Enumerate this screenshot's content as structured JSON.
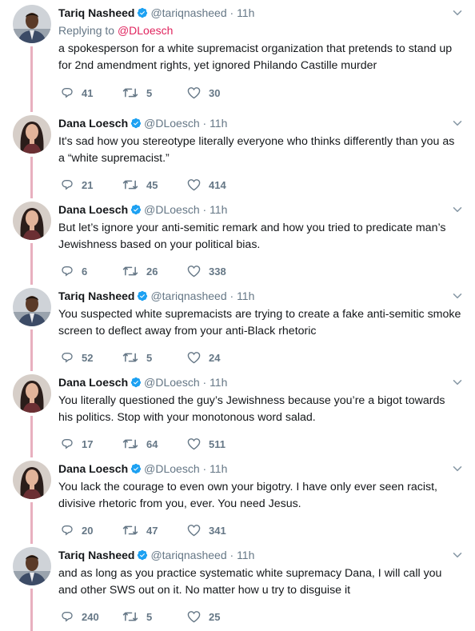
{
  "thread": {
    "tweets": [
      {
        "author": "tariq",
        "name": "Tariq Nasheed",
        "verified": true,
        "handle": "@tariqnasheed",
        "dot": "·",
        "time": "11h",
        "replying_label": "Replying to",
        "replying_handle": "@DLoesch",
        "text": "a spokesperson for a white supremacist organization that pretends to stand up for 2nd amendment rights, yet ignored Philando Castille murder",
        "replies": "41",
        "retweets": "5",
        "likes": "30"
      },
      {
        "author": "dana",
        "name": "Dana Loesch",
        "verified": true,
        "handle": "@DLoesch",
        "dot": "·",
        "time": "11h",
        "text": "It's sad how you stereotype literally everyone who thinks differently than you as a “white supremacist.”",
        "replies": "21",
        "retweets": "45",
        "likes": "414"
      },
      {
        "author": "dana",
        "name": "Dana Loesch",
        "verified": true,
        "handle": "@DLoesch",
        "dot": "·",
        "time": "11h",
        "text": "But let’s ignore your anti-semitic remark and how you tried to predicate man’s Jewishness  based on your political bias.",
        "replies": "6",
        "retweets": "26",
        "likes": "338"
      },
      {
        "author": "tariq",
        "name": "Tariq Nasheed",
        "verified": true,
        "handle": "@tariqnasheed",
        "dot": "·",
        "time": "11h",
        "text": "You suspected white supremacists are trying to create a fake anti-semitic smoke screen to deflect away from your anti-Black rhetoric",
        "replies": "52",
        "retweets": "5",
        "likes": "24"
      },
      {
        "author": "dana",
        "name": "Dana Loesch",
        "verified": true,
        "handle": "@DLoesch",
        "dot": "·",
        "time": "11h",
        "text": "You literally questioned the guy’s Jewishness because you’re a bigot towards his politics. Stop with your monotonous word salad.",
        "replies": "17",
        "retweets": "64",
        "likes": "511"
      },
      {
        "author": "dana",
        "name": "Dana Loesch",
        "verified": true,
        "handle": "@DLoesch",
        "dot": "·",
        "time": "11h",
        "text": "You lack the courage to even own your bigotry. I have only ever seen racist, divisive rhetoric from you, ever. You need Jesus.",
        "replies": "20",
        "retweets": "47",
        "likes": "341"
      },
      {
        "author": "tariq",
        "name": "Tariq Nasheed",
        "verified": true,
        "handle": "@tariqnasheed",
        "dot": "·",
        "time": "11h",
        "text": "and as long as you practice systematic white supremacy Dana, I will call you and other SWS out on it. No matter how u try to disguise it",
        "replies": "240",
        "retweets": "5",
        "likes": "25"
      }
    ]
  },
  "icons": {
    "reply": "reply-icon",
    "retweet": "retweet-icon",
    "like": "heart-icon",
    "caret": "chevron-down-icon",
    "verified": "verified-badge-icon"
  },
  "colors": {
    "thread_line": "#e8b0bf",
    "mention": "#e0245e",
    "verified": "#1da1f2",
    "muted": "#657786",
    "text": "#14171a"
  }
}
